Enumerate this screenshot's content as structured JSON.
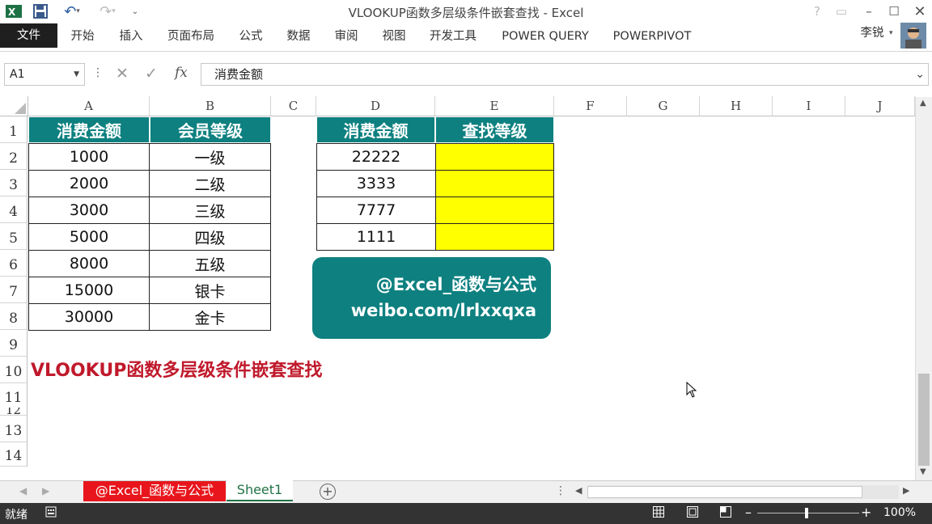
{
  "window": {
    "title": "VLOOKUP函数多层级条件嵌套查找 - Excel"
  },
  "ribbon": {
    "tabs": [
      "文件",
      "开始",
      "插入",
      "页面布局",
      "公式",
      "数据",
      "审阅",
      "视图",
      "开发工具",
      "POWER QUERY",
      "POWERPIVOT"
    ],
    "user": "李锐"
  },
  "formula_bar": {
    "name_box": "A1",
    "fx_label": "fx",
    "content": "消费金额"
  },
  "columns": [
    "A",
    "B",
    "C",
    "D",
    "E",
    "F",
    "G",
    "H",
    "I",
    "J"
  ],
  "rows": [
    "1",
    "2",
    "3",
    "4",
    "5",
    "6",
    "7",
    "8",
    "9",
    "10",
    "11",
    "12",
    "13",
    "14"
  ],
  "table_left": {
    "headers": [
      "消费金额",
      "会员等级"
    ],
    "rows": [
      [
        "1000",
        "一级"
      ],
      [
        "2000",
        "二级"
      ],
      [
        "3000",
        "三级"
      ],
      [
        "5000",
        "四级"
      ],
      [
        "8000",
        "五级"
      ],
      [
        "15000",
        "银卡"
      ],
      [
        "30000",
        "金卡"
      ]
    ]
  },
  "table_right": {
    "headers": [
      "消费金额",
      "查找等级"
    ],
    "rows": [
      [
        "22222",
        ""
      ],
      [
        "3333",
        ""
      ],
      [
        "7777",
        ""
      ],
      [
        "1111",
        ""
      ]
    ]
  },
  "banner": {
    "line1": "@Excel_函数与公式",
    "line2": "weibo.com/lrlxxqxa"
  },
  "heading": "VLOOKUP函数多层级条件嵌套查找",
  "sheet_tabs": [
    "@Excel_函数与公式",
    "Sheet1"
  ],
  "status": {
    "ready": "就绪",
    "zoom": "100%"
  },
  "colors": {
    "teal": "#0e8080",
    "highlight": "#ffff00",
    "heading_red": "#c0192b",
    "tab_red": "#e8161c"
  }
}
